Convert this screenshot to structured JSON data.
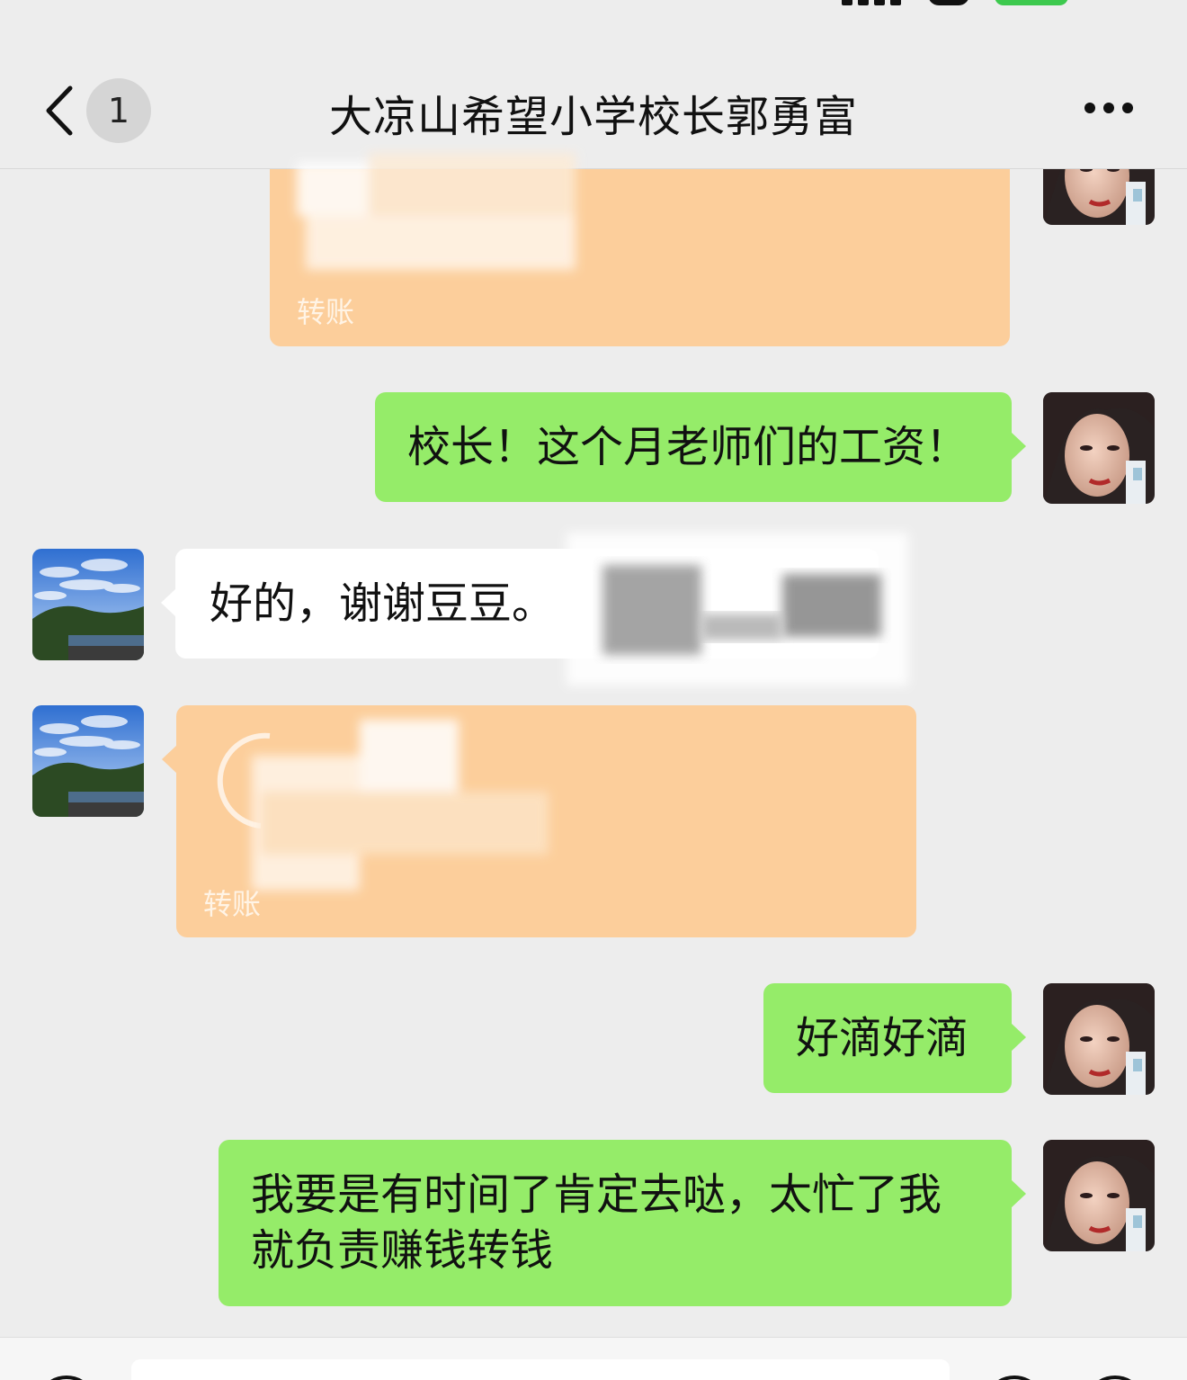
{
  "header": {
    "unread_count": "1",
    "title": "大凉山希望小学校长郭勇富"
  },
  "messages": [
    {
      "side": "right",
      "type": "transfer",
      "label": "转账"
    },
    {
      "side": "right",
      "type": "text",
      "text": "校长！这个月老师们的工资！"
    },
    {
      "side": "left",
      "type": "text",
      "text": "好的，谢谢豆豆。"
    },
    {
      "side": "left",
      "type": "transfer",
      "label": "转账"
    },
    {
      "side": "right",
      "type": "text",
      "text": "好滴好滴"
    },
    {
      "side": "right",
      "type": "text",
      "text": "我要是有时间了肯定去哒，太忙了我就负责赚钱转钱"
    }
  ],
  "colors": {
    "sent_bubble": "#95ec69",
    "received_bubble": "#ffffff",
    "transfer_bubble": "#fcce9b",
    "background": "#ededed"
  },
  "icons": {
    "back": "chevron-left-icon",
    "more": "ellipsis-icon",
    "voice": "voice-icon",
    "emoji": "emoji-icon",
    "plus": "plus-icon"
  }
}
